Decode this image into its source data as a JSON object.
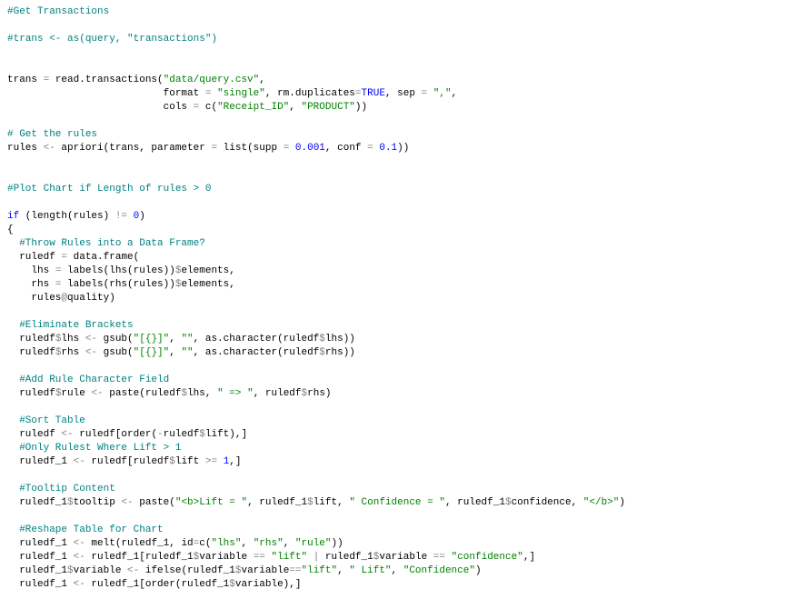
{
  "code": {
    "lines": [
      [
        {
          "t": "comment",
          "s": "#Get Transactions"
        }
      ],
      [],
      [
        {
          "t": "comment",
          "s": "#trans <- as(query, \"transactions\")"
        }
      ],
      [],
      [],
      [
        {
          "t": "plain",
          "s": "trans "
        },
        {
          "t": "op",
          "s": "="
        },
        {
          "t": "plain",
          "s": " read.transactions("
        },
        {
          "t": "string",
          "s": "\"data/query.csv\""
        },
        {
          "t": "plain",
          "s": ","
        }
      ],
      [
        {
          "t": "plain",
          "s": "                          format "
        },
        {
          "t": "op",
          "s": "="
        },
        {
          "t": "plain",
          "s": " "
        },
        {
          "t": "string",
          "s": "\"single\""
        },
        {
          "t": "plain",
          "s": ", rm.duplicates"
        },
        {
          "t": "op",
          "s": "="
        },
        {
          "t": "const",
          "s": "TRUE"
        },
        {
          "t": "plain",
          "s": ", sep "
        },
        {
          "t": "op",
          "s": "="
        },
        {
          "t": "plain",
          "s": " "
        },
        {
          "t": "string",
          "s": "\",\""
        },
        {
          "t": "plain",
          "s": ","
        }
      ],
      [
        {
          "t": "plain",
          "s": "                          cols "
        },
        {
          "t": "op",
          "s": "="
        },
        {
          "t": "plain",
          "s": " c("
        },
        {
          "t": "string",
          "s": "\"Receipt_ID\""
        },
        {
          "t": "plain",
          "s": ", "
        },
        {
          "t": "string",
          "s": "\"PRODUCT\""
        },
        {
          "t": "plain",
          "s": "))"
        }
      ],
      [],
      [
        {
          "t": "comment",
          "s": "# Get the rules"
        }
      ],
      [
        {
          "t": "plain",
          "s": "rules "
        },
        {
          "t": "op",
          "s": "<-"
        },
        {
          "t": "plain",
          "s": " apriori(trans, parameter "
        },
        {
          "t": "op",
          "s": "="
        },
        {
          "t": "plain",
          "s": " list(supp "
        },
        {
          "t": "op",
          "s": "="
        },
        {
          "t": "plain",
          "s": " "
        },
        {
          "t": "number",
          "s": "0.001"
        },
        {
          "t": "plain",
          "s": ", conf "
        },
        {
          "t": "op",
          "s": "="
        },
        {
          "t": "plain",
          "s": " "
        },
        {
          "t": "number",
          "s": "0.1"
        },
        {
          "t": "plain",
          "s": "))"
        }
      ],
      [],
      [],
      [
        {
          "t": "comment",
          "s": "#Plot Chart if Length of rules > 0"
        }
      ],
      [],
      [
        {
          "t": "keyword",
          "s": "if"
        },
        {
          "t": "plain",
          "s": " (length(rules) "
        },
        {
          "t": "op",
          "s": "!="
        },
        {
          "t": "plain",
          "s": " "
        },
        {
          "t": "number",
          "s": "0"
        },
        {
          "t": "plain",
          "s": ")"
        }
      ],
      [
        {
          "t": "plain",
          "s": "{"
        }
      ],
      [
        {
          "t": "plain",
          "s": "  "
        },
        {
          "t": "comment",
          "s": "#Throw Rules into a Data Frame?"
        }
      ],
      [
        {
          "t": "plain",
          "s": "  ruledf "
        },
        {
          "t": "op",
          "s": "="
        },
        {
          "t": "plain",
          "s": " data.frame("
        }
      ],
      [
        {
          "t": "plain",
          "s": "    lhs "
        },
        {
          "t": "op",
          "s": "="
        },
        {
          "t": "plain",
          "s": " labels(lhs(rules))"
        },
        {
          "t": "op",
          "s": "$"
        },
        {
          "t": "plain",
          "s": "elements,"
        }
      ],
      [
        {
          "t": "plain",
          "s": "    rhs "
        },
        {
          "t": "op",
          "s": "="
        },
        {
          "t": "plain",
          "s": " labels(rhs(rules))"
        },
        {
          "t": "op",
          "s": "$"
        },
        {
          "t": "plain",
          "s": "elements,"
        }
      ],
      [
        {
          "t": "plain",
          "s": "    rules"
        },
        {
          "t": "op",
          "s": "@"
        },
        {
          "t": "plain",
          "s": "quality)"
        }
      ],
      [],
      [
        {
          "t": "plain",
          "s": "  "
        },
        {
          "t": "comment",
          "s": "#Eliminate Brackets"
        }
      ],
      [
        {
          "t": "plain",
          "s": "  ruledf"
        },
        {
          "t": "op",
          "s": "$"
        },
        {
          "t": "plain",
          "s": "lhs "
        },
        {
          "t": "op",
          "s": "<-"
        },
        {
          "t": "plain",
          "s": " gsub("
        },
        {
          "t": "string",
          "s": "\"[{}]\""
        },
        {
          "t": "plain",
          "s": ", "
        },
        {
          "t": "string",
          "s": "\"\""
        },
        {
          "t": "plain",
          "s": ", as.character(ruledf"
        },
        {
          "t": "op",
          "s": "$"
        },
        {
          "t": "plain",
          "s": "lhs))"
        }
      ],
      [
        {
          "t": "plain",
          "s": "  ruledf"
        },
        {
          "t": "op",
          "s": "$"
        },
        {
          "t": "plain",
          "s": "rhs "
        },
        {
          "t": "op",
          "s": "<-"
        },
        {
          "t": "plain",
          "s": " gsub("
        },
        {
          "t": "string",
          "s": "\"[{}]\""
        },
        {
          "t": "plain",
          "s": ", "
        },
        {
          "t": "string",
          "s": "\"\""
        },
        {
          "t": "plain",
          "s": ", as.character(ruledf"
        },
        {
          "t": "op",
          "s": "$"
        },
        {
          "t": "plain",
          "s": "rhs))"
        }
      ],
      [],
      [
        {
          "t": "plain",
          "s": "  "
        },
        {
          "t": "comment",
          "s": "#Add Rule Character Field"
        }
      ],
      [
        {
          "t": "plain",
          "s": "  ruledf"
        },
        {
          "t": "op",
          "s": "$"
        },
        {
          "t": "plain",
          "s": "rule "
        },
        {
          "t": "op",
          "s": "<-"
        },
        {
          "t": "plain",
          "s": " paste(ruledf"
        },
        {
          "t": "op",
          "s": "$"
        },
        {
          "t": "plain",
          "s": "lhs, "
        },
        {
          "t": "string",
          "s": "\" => \""
        },
        {
          "t": "plain",
          "s": ", ruledf"
        },
        {
          "t": "op",
          "s": "$"
        },
        {
          "t": "plain",
          "s": "rhs)"
        }
      ],
      [],
      [
        {
          "t": "plain",
          "s": "  "
        },
        {
          "t": "comment",
          "s": "#Sort Table"
        }
      ],
      [
        {
          "t": "plain",
          "s": "  ruledf "
        },
        {
          "t": "op",
          "s": "<-"
        },
        {
          "t": "plain",
          "s": " ruledf[order("
        },
        {
          "t": "op",
          "s": "-"
        },
        {
          "t": "plain",
          "s": "ruledf"
        },
        {
          "t": "op",
          "s": "$"
        },
        {
          "t": "plain",
          "s": "lift),]"
        }
      ],
      [
        {
          "t": "plain",
          "s": "  "
        },
        {
          "t": "comment",
          "s": "#Only Rulest Where Lift > 1"
        }
      ],
      [
        {
          "t": "plain",
          "s": "  ruledf_1 "
        },
        {
          "t": "op",
          "s": "<-"
        },
        {
          "t": "plain",
          "s": " ruledf[ruledf"
        },
        {
          "t": "op",
          "s": "$"
        },
        {
          "t": "plain",
          "s": "lift "
        },
        {
          "t": "op",
          "s": ">="
        },
        {
          "t": "plain",
          "s": " "
        },
        {
          "t": "number",
          "s": "1"
        },
        {
          "t": "plain",
          "s": ",]"
        }
      ],
      [],
      [
        {
          "t": "plain",
          "s": "  "
        },
        {
          "t": "comment",
          "s": "#Tooltip Content"
        }
      ],
      [
        {
          "t": "plain",
          "s": "  ruledf_1"
        },
        {
          "t": "op",
          "s": "$"
        },
        {
          "t": "plain",
          "s": "tooltip "
        },
        {
          "t": "op",
          "s": "<-"
        },
        {
          "t": "plain",
          "s": " paste("
        },
        {
          "t": "string",
          "s": "\"<b>Lift = \""
        },
        {
          "t": "plain",
          "s": ", ruledf_1"
        },
        {
          "t": "op",
          "s": "$"
        },
        {
          "t": "plain",
          "s": "lift, "
        },
        {
          "t": "string",
          "s": "\" Confidence = \""
        },
        {
          "t": "plain",
          "s": ", ruledf_1"
        },
        {
          "t": "op",
          "s": "$"
        },
        {
          "t": "plain",
          "s": "confidence, "
        },
        {
          "t": "string",
          "s": "\"</b>\""
        },
        {
          "t": "plain",
          "s": ")"
        }
      ],
      [],
      [
        {
          "t": "plain",
          "s": "  "
        },
        {
          "t": "comment",
          "s": "#Reshape Table for Chart"
        }
      ],
      [
        {
          "t": "plain",
          "s": "  ruledf_1 "
        },
        {
          "t": "op",
          "s": "<-"
        },
        {
          "t": "plain",
          "s": " melt(ruledf_1, id"
        },
        {
          "t": "op",
          "s": "="
        },
        {
          "t": "plain",
          "s": "c("
        },
        {
          "t": "string",
          "s": "\"lhs\""
        },
        {
          "t": "plain",
          "s": ", "
        },
        {
          "t": "string",
          "s": "\"rhs\""
        },
        {
          "t": "plain",
          "s": ", "
        },
        {
          "t": "string",
          "s": "\"rule\""
        },
        {
          "t": "plain",
          "s": "))"
        }
      ],
      [
        {
          "t": "plain",
          "s": "  ruledf_1 "
        },
        {
          "t": "op",
          "s": "<-"
        },
        {
          "t": "plain",
          "s": " ruledf_1[ruledf_1"
        },
        {
          "t": "op",
          "s": "$"
        },
        {
          "t": "plain",
          "s": "variable "
        },
        {
          "t": "op",
          "s": "=="
        },
        {
          "t": "plain",
          "s": " "
        },
        {
          "t": "string",
          "s": "\"lift\""
        },
        {
          "t": "plain",
          "s": " "
        },
        {
          "t": "op",
          "s": "|"
        },
        {
          "t": "plain",
          "s": " ruledf_1"
        },
        {
          "t": "op",
          "s": "$"
        },
        {
          "t": "plain",
          "s": "variable "
        },
        {
          "t": "op",
          "s": "=="
        },
        {
          "t": "plain",
          "s": " "
        },
        {
          "t": "string",
          "s": "\"confidence\""
        },
        {
          "t": "plain",
          "s": ",]"
        }
      ],
      [
        {
          "t": "plain",
          "s": "  ruledf_1"
        },
        {
          "t": "op",
          "s": "$"
        },
        {
          "t": "plain",
          "s": "variable "
        },
        {
          "t": "op",
          "s": "<-"
        },
        {
          "t": "plain",
          "s": " ifelse(ruledf_1"
        },
        {
          "t": "op",
          "s": "$"
        },
        {
          "t": "plain",
          "s": "variable"
        },
        {
          "t": "op",
          "s": "=="
        },
        {
          "t": "string",
          "s": "\"lift\""
        },
        {
          "t": "plain",
          "s": ", "
        },
        {
          "t": "string",
          "s": "\" Lift\""
        },
        {
          "t": "plain",
          "s": ", "
        },
        {
          "t": "string",
          "s": "\"Confidence\""
        },
        {
          "t": "plain",
          "s": ")"
        }
      ],
      [
        {
          "t": "plain",
          "s": "  ruledf_1 "
        },
        {
          "t": "op",
          "s": "<-"
        },
        {
          "t": "plain",
          "s": " ruledf_1[order(ruledf_1"
        },
        {
          "t": "op",
          "s": "$"
        },
        {
          "t": "plain",
          "s": "variable),]"
        }
      ]
    ]
  }
}
